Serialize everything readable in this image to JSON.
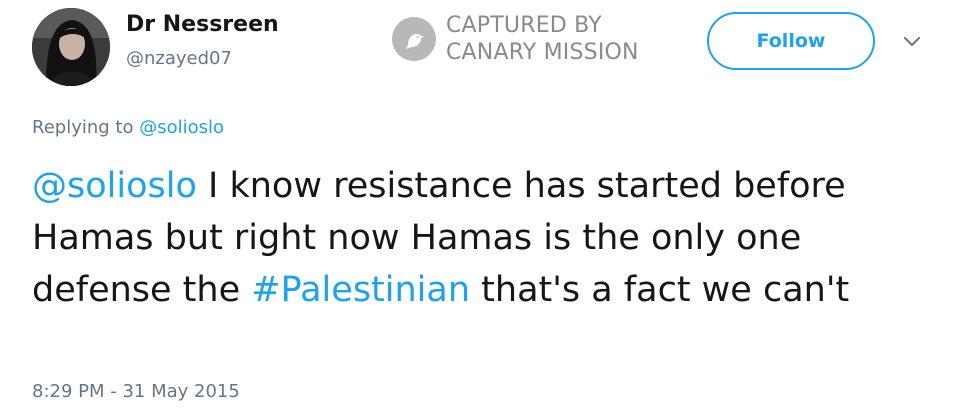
{
  "author": {
    "display_name": "Dr Nessreen",
    "handle": "@nzayed07"
  },
  "watermark": {
    "line1": "CAPTURED BY",
    "line2": "CANARY MISSION",
    "icon": "canary-bird-icon"
  },
  "actions": {
    "follow_label": "Follow",
    "more_icon": "chevron-down-icon"
  },
  "reply_context": {
    "prefix": "Replying to",
    "mention": "@solioslo"
  },
  "tweet": {
    "mention": "@solioslo",
    "text_part1": " I know resistance has started before Hamas but right now Hamas is the only one defense the ",
    "hashtag": "#Palestinian",
    "text_part2": " that's a fact we can't"
  },
  "timestamp": "8:29 PM - 31 May 2015",
  "colors": {
    "link": "#1da1f2",
    "secondary_text": "#657786",
    "primary_text": "#14171a",
    "watermark": "#8a8a8a"
  }
}
